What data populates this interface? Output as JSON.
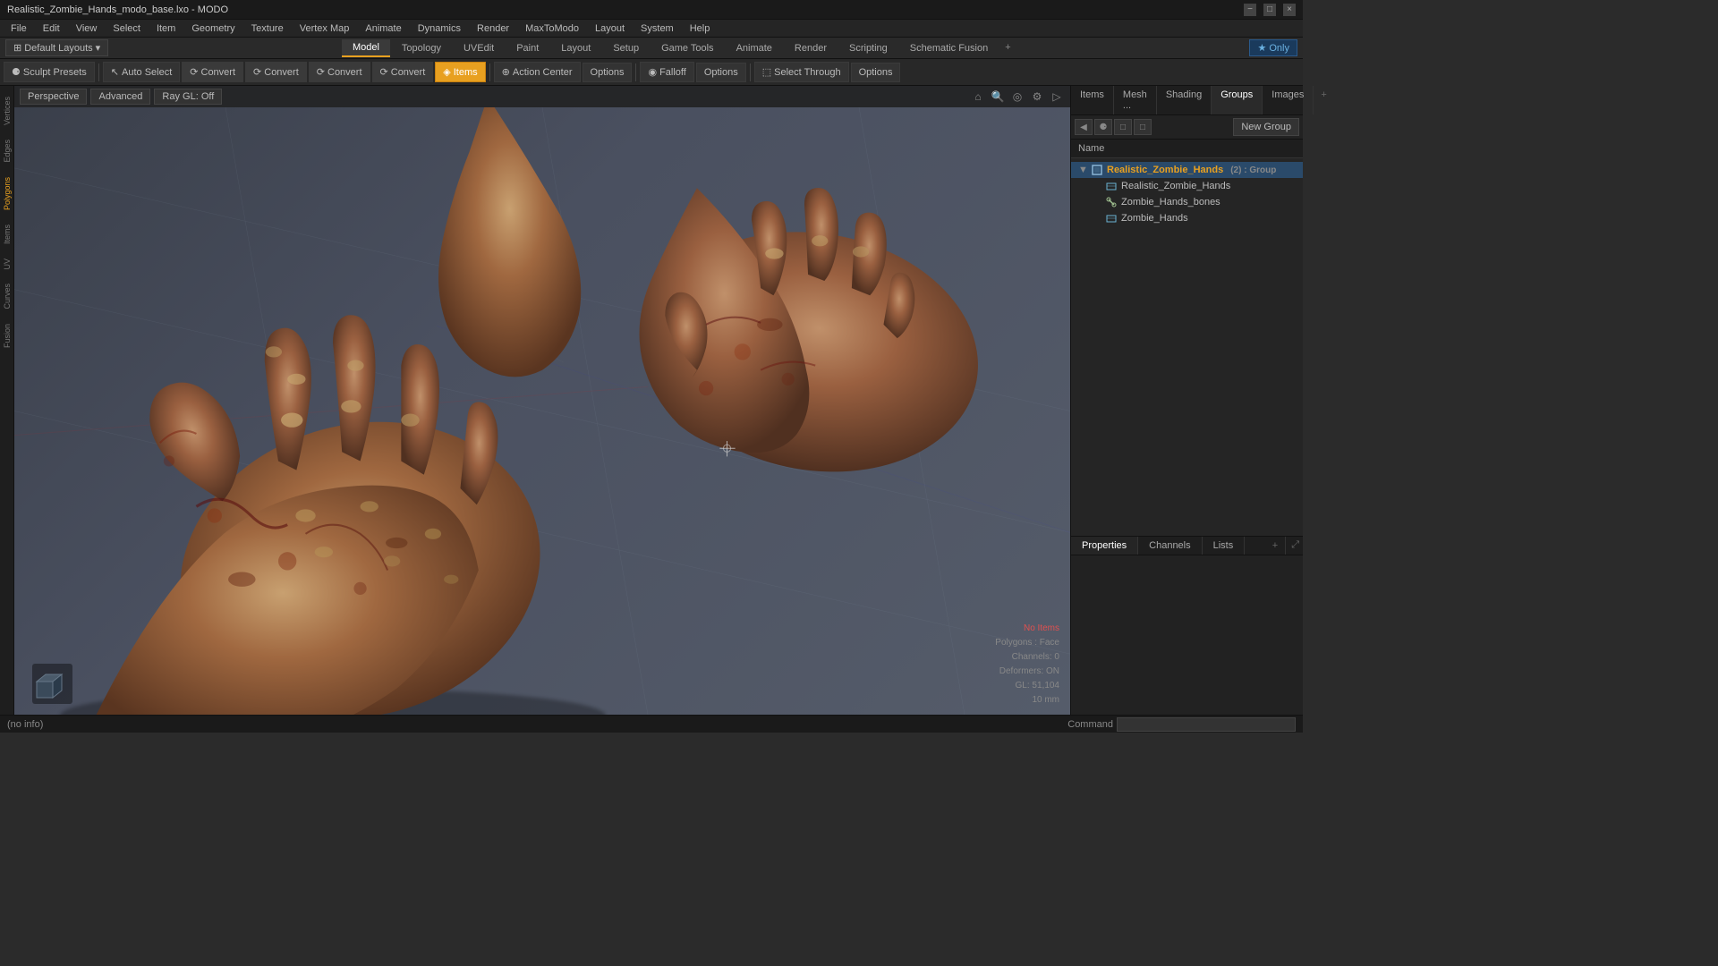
{
  "titlebar": {
    "title": "Realistic_Zombie_Hands_modo_base.lxo - MODO",
    "controls": [
      "−",
      "□",
      "×"
    ]
  },
  "menubar": {
    "items": [
      "File",
      "Edit",
      "View",
      "Select",
      "Item",
      "Geometry",
      "Texture",
      "Vertex Map",
      "Animate",
      "Dynamics",
      "Render",
      "MaxToModo",
      "Layout",
      "System",
      "Help"
    ]
  },
  "layout_bar": {
    "left_btn": "Default Layouts",
    "tabs": [
      "Model",
      "Topology",
      "UVEdit",
      "Paint",
      "Layout",
      "Setup",
      "Game Tools",
      "Animate",
      "Render",
      "Scripting",
      "Schematic Fusion"
    ],
    "active_tab": "Model",
    "plus_label": "+",
    "only_label": "Only",
    "star_icon": "★"
  },
  "tool_bar": {
    "sculpt_presets": "Sculpt Presets",
    "sculpt_icon": "⚈",
    "presets_label": "Presets",
    "auto_select_label": "Auto Select",
    "convert_buttons": [
      "Convert",
      "Convert",
      "Convert",
      "Convert"
    ],
    "items_label": "Items",
    "action_center_label": "Action Center",
    "options1_label": "Options",
    "falloff_label": "Falloff",
    "options2_label": "Options",
    "select_through_label": "Select Through",
    "options3_label": "Options"
  },
  "viewport": {
    "perspective_label": "Perspective",
    "advanced_label": "Advanced",
    "ray_gl_label": "Ray GL: Off",
    "icons": [
      "⊕",
      "🔍",
      "◎",
      "⚙",
      "▷"
    ]
  },
  "scene_info": {
    "no_items": "No Items",
    "polygons": "Polygons : Face",
    "channels": "Channels: 0",
    "deformers": "Deformers: ON",
    "gl": "GL: 51,104",
    "scale": "10 mm"
  },
  "right_panel": {
    "tabs": [
      "Items",
      "Mesh ...",
      "Shading",
      "Groups",
      "Images"
    ],
    "active_tab": "Groups",
    "plus_label": "+",
    "new_group_label": "New Group",
    "name_header": "Name",
    "toolbar_btns": [
      "◀",
      "⚈",
      "□",
      "□"
    ],
    "tree": {
      "group_name": "Realistic_Zombie_Hands",
      "group_count": "(2) : Group",
      "children": [
        {
          "label": "Realistic_Zombie_Hands",
          "type": "mesh",
          "indent": 1
        },
        {
          "label": "Zombie_Hands_bones",
          "type": "bone",
          "indent": 1
        },
        {
          "label": "Zombie_Hands",
          "type": "mesh",
          "indent": 1
        }
      ]
    }
  },
  "bottom_panel": {
    "tabs": [
      "Properties",
      "Channels",
      "Lists"
    ],
    "active_tab": "Properties",
    "plus_label": "+"
  },
  "statusbar": {
    "status_text": "(no info)",
    "command_label": "Command"
  },
  "left_modes": [
    "Vertices",
    "Edges",
    "Polygons",
    "Items",
    "UV",
    "Curves",
    "Fusion"
  ]
}
